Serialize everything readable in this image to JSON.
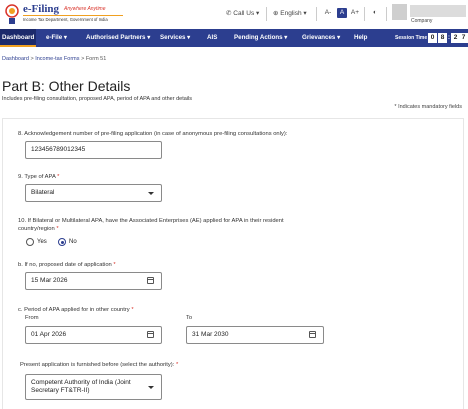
{
  "header": {
    "logo_title": "e-Filing",
    "logo_tagline": "Anywhere Anytime",
    "logo_subtitle": "Income Tax Department, Government of India",
    "call_us": "Call Us",
    "language": "English",
    "font_decrease": "A-",
    "font_normal": "A",
    "font_increase": "A+",
    "contrast": "◐",
    "company_label": "Company"
  },
  "nav": {
    "items": [
      {
        "label": "Dashboard"
      },
      {
        "label": "e-File ▾"
      },
      {
        "label": "Authorised Partners ▾"
      },
      {
        "label": "Services ▾"
      },
      {
        "label": "AIS"
      },
      {
        "label": "Pending Actions ▾"
      },
      {
        "label": "Grievances ▾"
      },
      {
        "label": "Help"
      }
    ],
    "session_label": "Session Time",
    "session_time": [
      "0",
      "8",
      ":",
      "2",
      "7"
    ]
  },
  "breadcrumb": {
    "items": [
      "Dashboard",
      "Income-tax Forms",
      "Form 51"
    ],
    "separator": ">"
  },
  "page": {
    "title": "Part B: Other Details",
    "subtitle": "Includes pre-filing consultation, proposed APA, period of APA and other details",
    "mandatory_note": "* Indicates mandatory fields"
  },
  "form": {
    "q8_label": "8. Acknowledgement number of pre-filing application (in case of anonymous pre-filing consultations only):",
    "q8_value": "123456789012345",
    "q9_label": "9. Type of APA",
    "q9_value": "Bilateral",
    "q10_label": "10. If Bilateral or Multilateral APA, have the Associated Enterprises (AE) applied for APA in their resident country/region",
    "q10_yes": "Yes",
    "q10_no": "No",
    "q10_selected": "No",
    "qb_label": "b. If no, proposed date of application",
    "qb_value": "15 Mar 2026",
    "qc_label": "c. Period of APA applied for in other country",
    "qc_from_label": "From",
    "qc_from_value": "01 Apr 2026",
    "qc_to_label": "To",
    "qc_to_value": "31 Mar 2030",
    "authority_label": "Present application is furnished before (select the authority):",
    "authority_value": "Competent Authority of India (Joint Secretary FT&TR-II)",
    "required_mark": "*"
  },
  "colors": {
    "primary": "#2c3e8f",
    "accent": "#f0a020",
    "required": "#d9342b"
  }
}
